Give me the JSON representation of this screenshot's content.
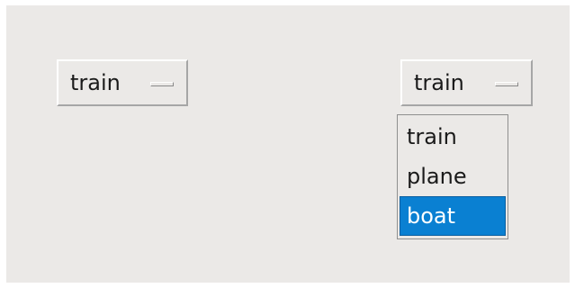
{
  "option_menus": [
    {
      "selected_value": "train"
    },
    {
      "selected_value": "train"
    }
  ],
  "dropdown": {
    "options": [
      "train",
      "plane",
      "boat"
    ],
    "highlighted": "boat"
  },
  "colors": {
    "background": "#ebe9e7",
    "highlight": "#0a80d2",
    "highlight_text": "#ffffff",
    "text": "#1a1a1a"
  }
}
